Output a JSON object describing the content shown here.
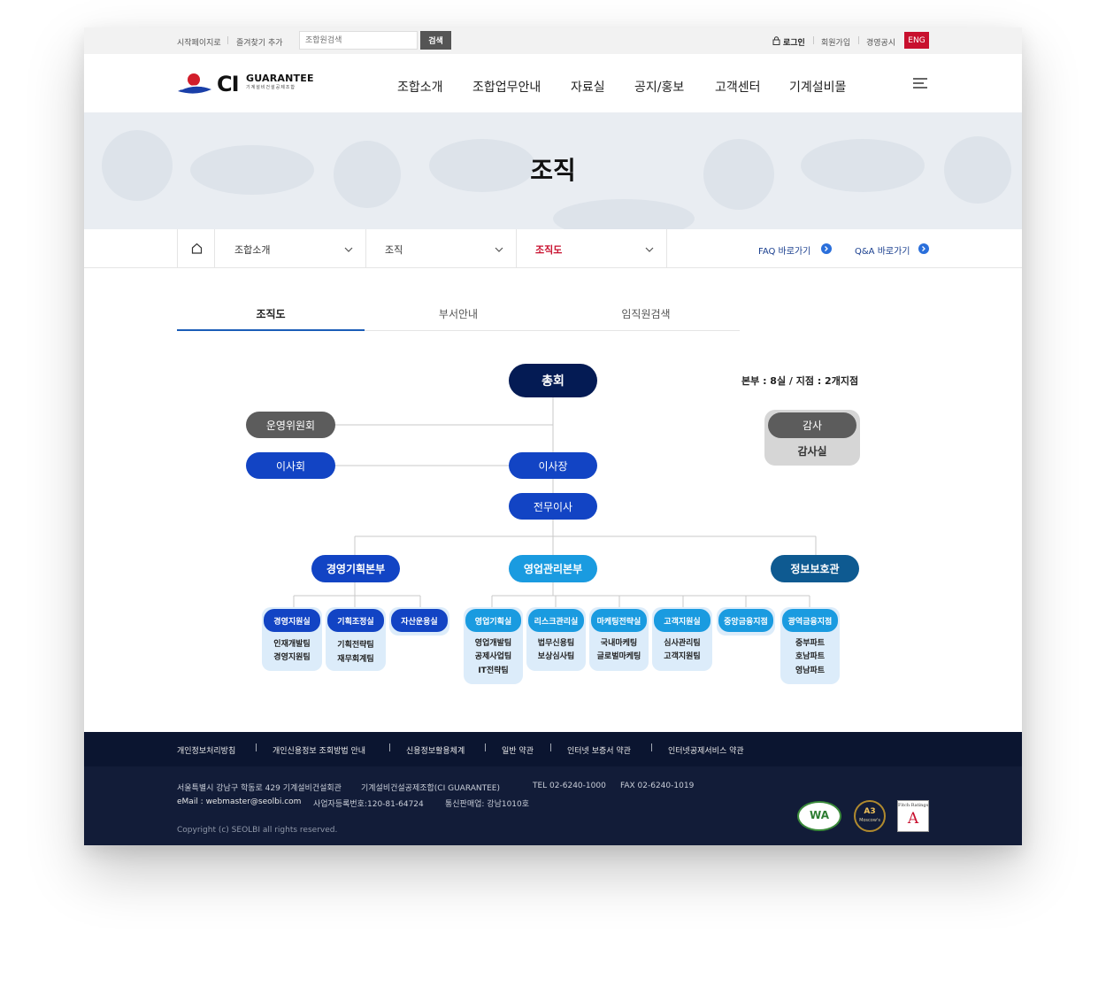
{
  "utility": {
    "start_page": "시작페이지로",
    "bookmark": "즐겨찾기 추가",
    "search_placeholder": "조합원검색",
    "search_button": "검색",
    "login": "로그인",
    "signup": "회원가입",
    "disclosure": "경영공시",
    "lang": "ENG"
  },
  "header": {
    "logo_ci": "CI",
    "logo_name": "GUARANTEE",
    "logo_sub": "기계설비건설공제조합",
    "nav": [
      "조합소개",
      "조합업무안내",
      "자료실",
      "공지/홍보",
      "고객센터",
      "기계설비몰"
    ]
  },
  "hero": {
    "title": "조직"
  },
  "location": {
    "level1": "조합소개",
    "level2": "조직",
    "level3": "조직도",
    "faq": "FAQ 바로가기",
    "qna": "Q&A 바로가기"
  },
  "tabs": [
    "조직도",
    "부서안내",
    "임직원검색"
  ],
  "org": {
    "summary": "본부 : 8실 / 지점 : 2개지점",
    "general_meeting": "총회",
    "steering_committee": "운영위원회",
    "board": "이사회",
    "chairman": "이사장",
    "executive_director": "전무이사",
    "audit": "감사",
    "audit_office": "감사실",
    "hq_planning": "경영기획본부",
    "hq_sales": "영업관리본부",
    "privacy_officer": "정보보호관",
    "depts": [
      {
        "name": "경영지원실",
        "teams": [
          "인재개발팀",
          "경영지원팀"
        ]
      },
      {
        "name": "기획조정실",
        "teams": [
          "기획전략팀",
          "재무회계팀"
        ]
      },
      {
        "name": "자산운용실",
        "teams": []
      },
      {
        "name": "영업기획실",
        "teams": [
          "영업개발팀",
          "공제사업팀",
          "IT전략팀"
        ]
      },
      {
        "name": "리스크관리실",
        "teams": [
          "법무신용팀",
          "보상심사팀"
        ]
      },
      {
        "name": "마케팅전략실",
        "teams": [
          "국내마케팅",
          "글로벌마케팅"
        ]
      },
      {
        "name": "고객지원실",
        "teams": [
          "심사관리팀",
          "고객지원팀"
        ]
      },
      {
        "name": "중앙금융지점",
        "teams": []
      },
      {
        "name": "광역금융지점",
        "teams": [
          "중부파트",
          "호남파트",
          "영남파트"
        ]
      }
    ]
  },
  "footer": {
    "links": [
      "개인정보처리방침",
      "개인신용정보 조회방법 안내",
      "신용정보활용체계",
      "일반 약관",
      "인터넷 보증서 약관",
      "인터넷공제서비스 약관"
    ],
    "address": "서울특별시 강남구 학동로 429 기계설비건설회관",
    "org_name": "기계설비건설공제조합(CI GUARANTEE)",
    "tel": "TEL 02-6240-1000",
    "fax": "FAX 02-6240-1019",
    "email": "eMail : webmaster@seolbi.com",
    "biz_no": "사업자등록번호:120-81-64724",
    "mail_order": "통신판매업: 강남1010호",
    "copyright": "Copyright (c) SEOLBI all rights reserved.",
    "badge_wa": "WA",
    "badge_a3": "A3",
    "badge_a3_sub": "Moscow's",
    "badge_fitch": "Fitch Ratings",
    "badge_fitch_grade": "A"
  },
  "colors": {
    "navy": "#041b54",
    "blue": "#1244c4",
    "sky": "#1a9be0",
    "teal": "#0e5a91",
    "gray": "#5c5c5c",
    "accent_red": "#c8102e"
  }
}
